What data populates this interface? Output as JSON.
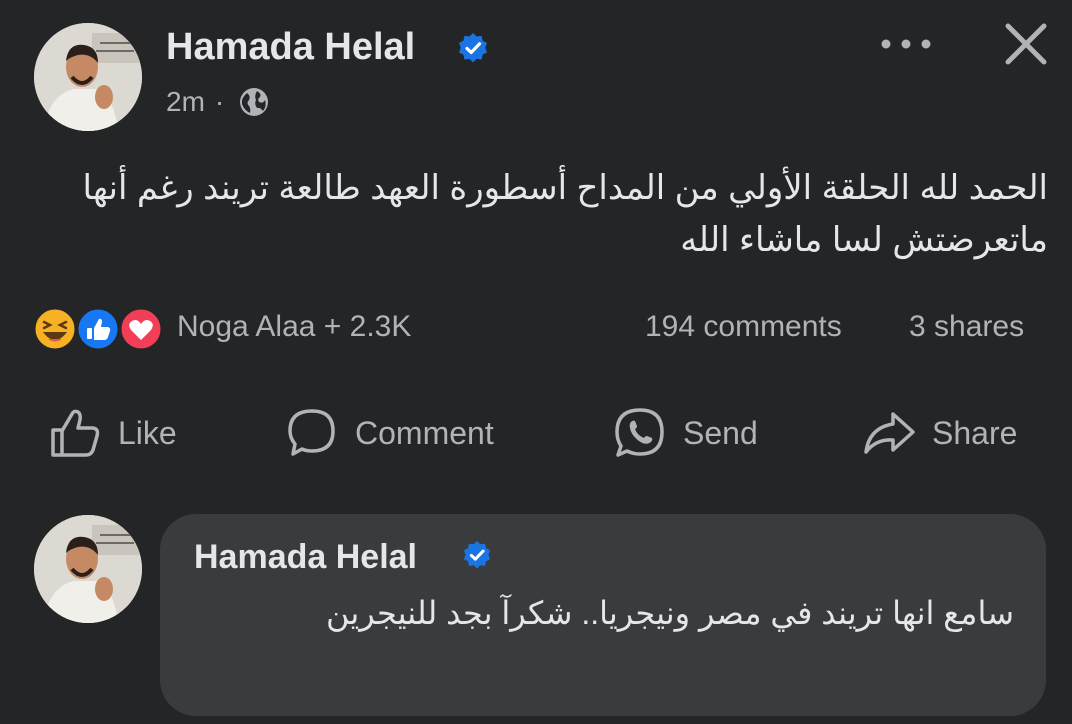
{
  "post": {
    "author": "Hamada Helal",
    "time": "2m",
    "separator": "·",
    "privacy_icon": "globe-icon",
    "verified_icon": "verified-badge-icon",
    "text": "الحمد لله الحلقة الأولي من المداح أسطورة العهد طالعة تريند رغم أنها ماتعرضتش لسا ماشاء الله"
  },
  "header_actions": {
    "more_icon": "more-options-icon",
    "close_icon": "close-icon"
  },
  "stats": {
    "reaction_icons": [
      "haha-icon",
      "like-reaction-icon",
      "love-icon"
    ],
    "reactions_label": "Noga Alaa + 2.3K",
    "comments": "194 comments",
    "shares": "3 shares"
  },
  "actions": {
    "like": "Like",
    "comment": "Comment",
    "send": "Send",
    "share": "Share"
  },
  "reply": {
    "author": "Hamada Helal",
    "text": "سامع انها تريند في مصر ونيجريا.. شكرآ بجد للنيجرين"
  },
  "colors": {
    "background": "#242526",
    "bubble": "#3a3b3c",
    "text_primary": "#e4e6eb",
    "text_secondary": "#b0b3b8",
    "verified_blue": "#1b74e4",
    "like_blue": "#1877f2",
    "love_red": "#f33e58",
    "haha_yellow": "#f7b125"
  }
}
